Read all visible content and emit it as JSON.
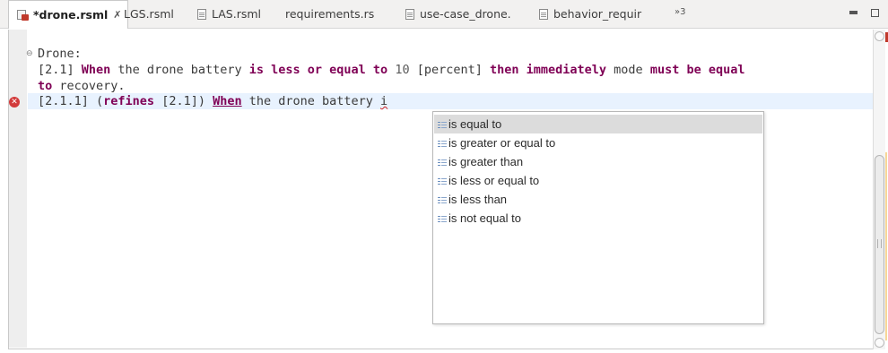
{
  "tabs": [
    {
      "label": "*drone.rsml",
      "close": "✗",
      "active": true,
      "icon": "rsml-file-icon"
    },
    {
      "label": "LGS.rsml",
      "icon": "none"
    },
    {
      "label": "LAS.rsml",
      "icon": "file-icon"
    },
    {
      "label": "requirements.rs",
      "icon": "none"
    },
    {
      "label": "use-case_drone.",
      "icon": "file-icon"
    },
    {
      "label": "behavior_requir",
      "icon": "file-icon"
    }
  ],
  "tab_overflow": "»3",
  "editor": {
    "line1": "Drone:",
    "line2": {
      "a": "[2.1] ",
      "b": "When",
      "c": " the drone battery ",
      "d": "is less or equal to",
      "e": " ",
      "f": "10",
      "g": " [percent] ",
      "h": "then immediately",
      "i": " mode ",
      "j": "must be equal"
    },
    "line3": {
      "a": "to",
      "b": " recovery."
    },
    "line4": {
      "a": "[2.1.1] (",
      "b": "refines",
      "c": " [2.1]) ",
      "d": "When",
      "e": " the drone battery ",
      "f": "i"
    }
  },
  "content_assist": {
    "items": [
      "is equal to",
      "is greater or equal to",
      "is greater than",
      "is less or equal to",
      "is less than",
      "is not equal to"
    ],
    "selected_index": 0
  },
  "colors": {
    "keyword": "#7f0055",
    "current_line": "#e8f2fe",
    "selection": "#dcdcdc",
    "error": "#d23b3b"
  }
}
